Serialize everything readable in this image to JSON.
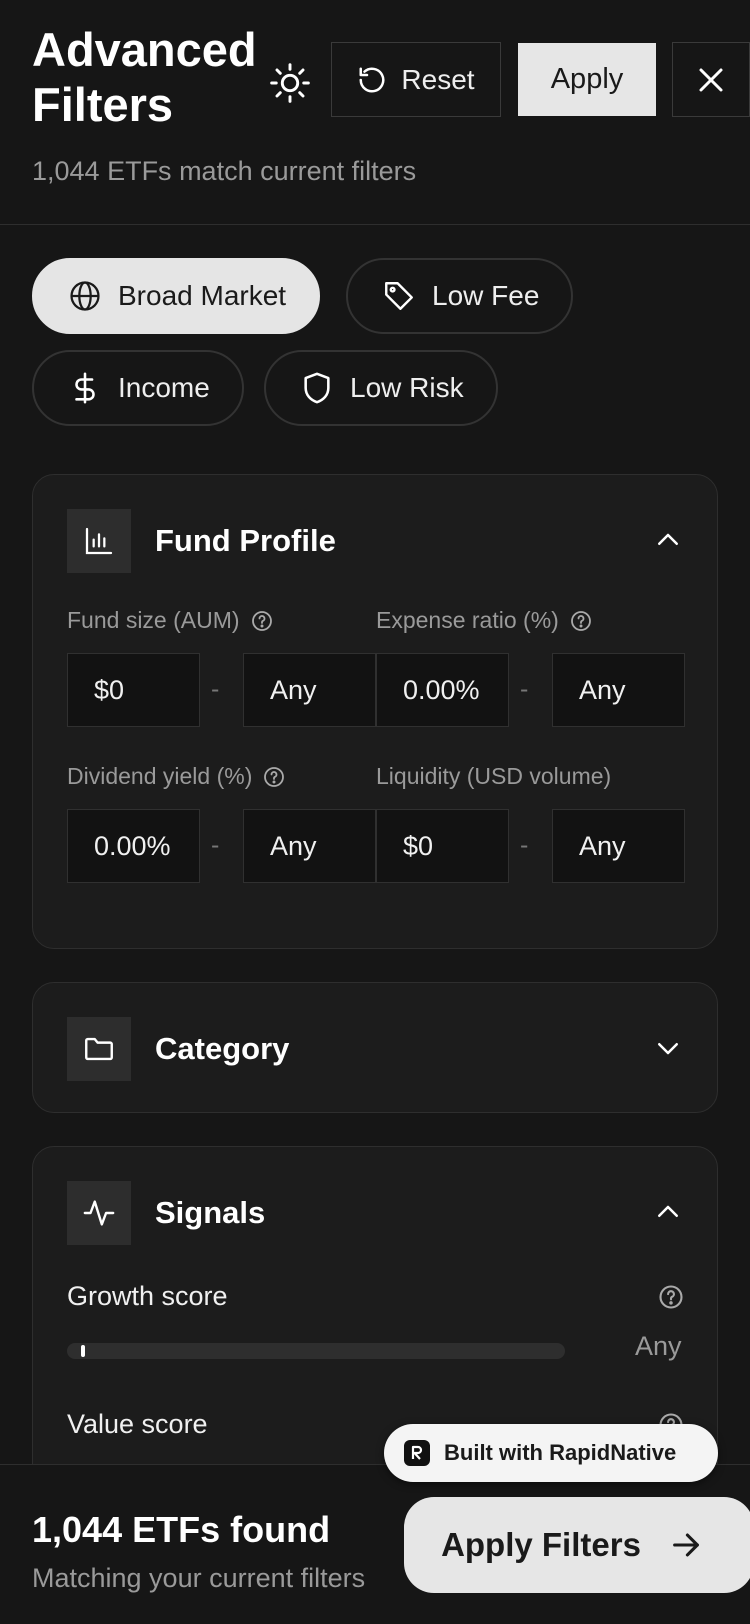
{
  "header": {
    "title": "Advanced Filters",
    "subtitle": "1,044 ETFs match current filters",
    "reset_label": "Reset",
    "apply_label": "Apply"
  },
  "chips": [
    {
      "label": "Broad Market",
      "icon": "globe-icon",
      "active": true
    },
    {
      "label": "Low Fee",
      "icon": "tag-icon",
      "active": false
    },
    {
      "label": "Income",
      "icon": "dollar-icon",
      "active": false
    },
    {
      "label": "Low Risk",
      "icon": "shield-icon",
      "active": false
    }
  ],
  "fund_profile": {
    "title": "Fund Profile",
    "expanded": true,
    "filters": [
      {
        "label": "Fund size (AUM)",
        "help": true,
        "min": "$0",
        "max": "Any"
      },
      {
        "label": "Expense ratio (%)",
        "help": true,
        "min": "0.00%",
        "max": "Any"
      },
      {
        "label": "Dividend yield (%)",
        "help": true,
        "min": "0.00%",
        "max": "Any"
      },
      {
        "label": "Liquidity (USD volume)",
        "help": false,
        "min": "$0",
        "max": "Any"
      }
    ],
    "separator": "-"
  },
  "category": {
    "title": "Category",
    "expanded": false
  },
  "signals": {
    "title": "Signals",
    "expanded": true,
    "items": [
      {
        "label": "Growth score",
        "value": "Any",
        "level": 0
      },
      {
        "label": "Value score"
      }
    ]
  },
  "badge": {
    "label": "Built with RapidNative"
  },
  "footer": {
    "count": "1,044 ETFs found",
    "subtitle": "Matching your current filters",
    "apply_filters_label": "Apply Filters"
  },
  "colors": {
    "background": "#161616",
    "card": "#1c1c1c",
    "accent": "#e6e6e6"
  }
}
